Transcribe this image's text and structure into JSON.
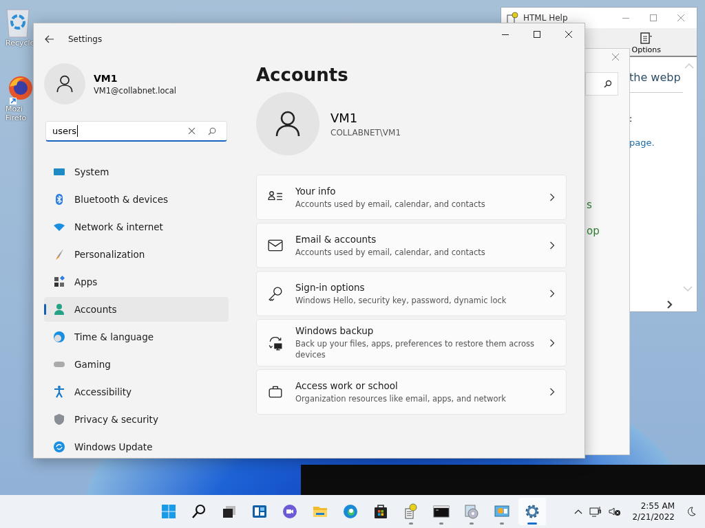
{
  "desktop_icons": [
    {
      "kind": "recycle-bin",
      "lines": [
        "Recycle"
      ]
    },
    {
      "kind": "firefox",
      "lines": [
        "Mozi",
        "Firefo"
      ]
    }
  ],
  "help_window": {
    "title": "HTML Help",
    "toolbar": [
      "Options"
    ],
    "heading": "the webp",
    "text": ":",
    "link": "page."
  },
  "middle_window": {
    "fragments": [
      "s",
      "op"
    ]
  },
  "settings": {
    "title": "Settings",
    "user": {
      "name": "VM1",
      "email": "VM1@collabnet.local"
    },
    "search": {
      "value": "users"
    },
    "nav": [
      {
        "kind": "system",
        "label": "System",
        "selected": false
      },
      {
        "kind": "bluetooth",
        "label": "Bluetooth & devices",
        "selected": false
      },
      {
        "kind": "network",
        "label": "Network & internet",
        "selected": false
      },
      {
        "kind": "brush",
        "label": "Personalization",
        "selected": false
      },
      {
        "kind": "apps",
        "label": "Apps",
        "selected": false
      },
      {
        "kind": "accounts",
        "label": "Accounts",
        "selected": true
      },
      {
        "kind": "time",
        "label": "Time & language",
        "selected": false
      },
      {
        "kind": "gaming",
        "label": "Gaming",
        "selected": false
      },
      {
        "kind": "accessibility",
        "label": "Accessibility",
        "selected": false
      },
      {
        "kind": "privacy",
        "label": "Privacy & security",
        "selected": false
      },
      {
        "kind": "update",
        "label": "Windows Update",
        "selected": false
      }
    ],
    "page_title": "Accounts",
    "account": {
      "name": "VM1",
      "domain": "COLLABNET\\VM1"
    },
    "cards": [
      {
        "kind": "info",
        "title": "Your info",
        "subtitle": "Accounts used by email, calendar, and contacts"
      },
      {
        "kind": "mail",
        "title": "Email & accounts",
        "subtitle": "Accounts used by email, calendar, and contacts"
      },
      {
        "kind": "key",
        "title": "Sign-in options",
        "subtitle": "Windows Hello, security key, password, dynamic lock"
      },
      {
        "kind": "backup",
        "title": "Windows backup",
        "subtitle": "Back up your files, apps, preferences to restore them across devices"
      },
      {
        "kind": "briefcase",
        "title": "Access work or school",
        "subtitle": "Organization resources like email, apps, and network"
      }
    ]
  },
  "taskbar": {
    "apps": [
      {
        "kind": "start",
        "running": false,
        "selected": false
      },
      {
        "kind": "search",
        "running": false,
        "selected": false
      },
      {
        "kind": "taskview",
        "running": false,
        "selected": false
      },
      {
        "kind": "widgets",
        "running": false,
        "selected": false
      },
      {
        "kind": "chat",
        "running": false,
        "selected": false
      },
      {
        "kind": "explorer",
        "running": false,
        "selected": false
      },
      {
        "kind": "edge",
        "running": false,
        "selected": false
      },
      {
        "kind": "store",
        "running": false,
        "selected": false
      },
      {
        "kind": "help",
        "running": true,
        "selected": false
      },
      {
        "kind": "cmd",
        "running": true,
        "selected": false
      },
      {
        "kind": "disc",
        "running": true,
        "selected": false
      },
      {
        "kind": "panel",
        "running": true,
        "selected": false
      },
      {
        "kind": "settings",
        "running": true,
        "selected": true
      }
    ],
    "time": "2:55 AM",
    "date": "2/21/2022"
  }
}
